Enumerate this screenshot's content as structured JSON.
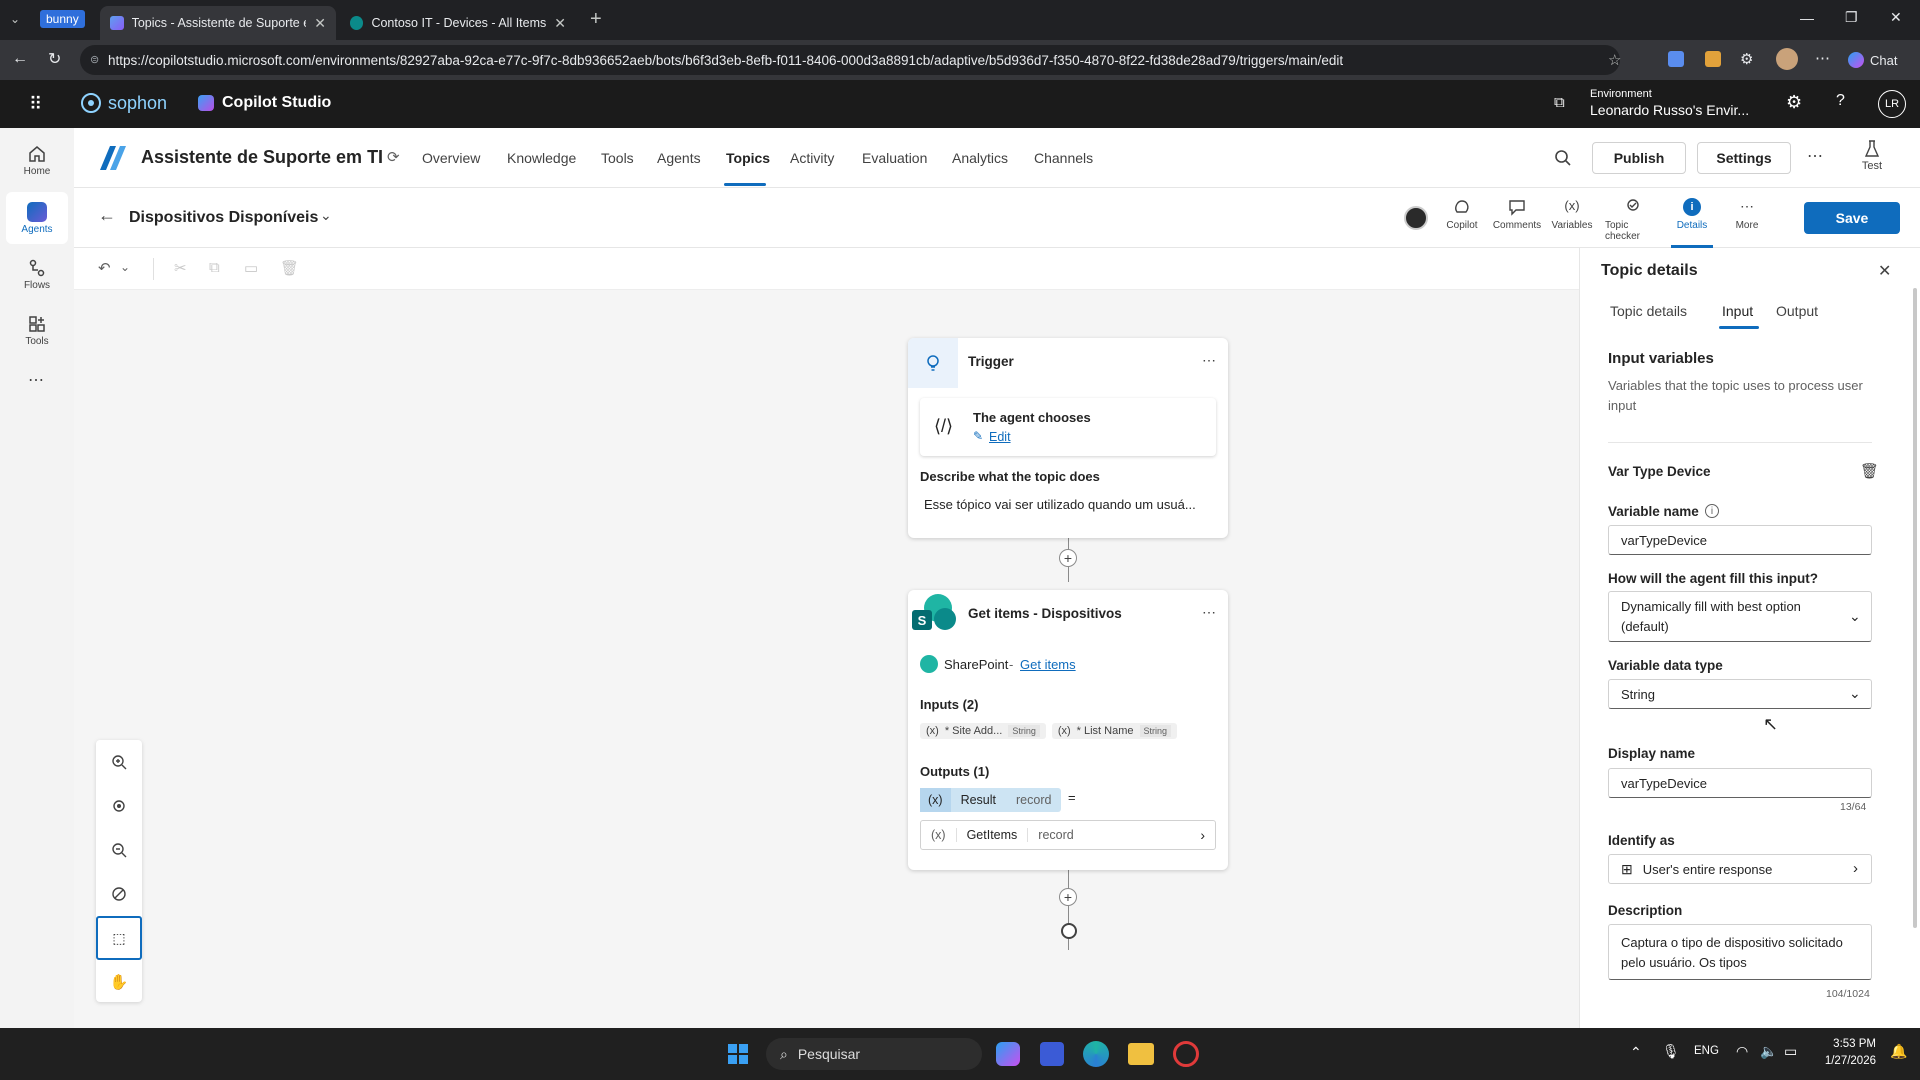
{
  "browser": {
    "profile_badge": "bunny",
    "tabs": [
      {
        "title": "Topics - Assistente de Suporte em"
      },
      {
        "title": "Contoso IT - Devices - All Items"
      }
    ],
    "url": "https://copilotstudio.microsoft.com/environments/82927aba-92ca-e77c-9f7c-8db936652aeb/bots/b6f3d3eb-8efb-f011-8406-000d3a8891cb/adaptive/b5d936d7-f350-4870-8f22-fd38de28ad79/triggers/main/edit",
    "chat_label": "Chat"
  },
  "app": {
    "brand": "sophon",
    "product": "Copilot Studio",
    "env_label": "Environment",
    "env_name": "Leonardo Russo's Envir...",
    "avatar": "LR"
  },
  "rail": {
    "items": [
      {
        "label": "Home"
      },
      {
        "label": "Agents"
      },
      {
        "label": "Flows"
      },
      {
        "label": "Tools"
      }
    ]
  },
  "agent": {
    "name": "Assistente de Suporte em TI",
    "nav": [
      "Overview",
      "Knowledge",
      "Tools",
      "Agents",
      "Topics",
      "Activity",
      "Evaluation",
      "Analytics",
      "Channels"
    ],
    "publish": "Publish",
    "settings": "Settings",
    "test": "Test"
  },
  "topic": {
    "title": "Dispositivos Disponíveis",
    "tools": [
      {
        "label": "Copilot"
      },
      {
        "label": "Comments"
      },
      {
        "label": "Variables"
      },
      {
        "label": "Topic checker"
      },
      {
        "label": "Details"
      },
      {
        "label": "More"
      }
    ],
    "save": "Save"
  },
  "trigger_node": {
    "title": "Trigger",
    "chooser": "The agent chooses",
    "edit": "Edit",
    "describe_label": "Describe what the topic does",
    "describe_value": "Esse tópico vai ser utilizado quando um usuá..."
  },
  "action_node": {
    "title": "Get items - Dispositivos",
    "connector": "SharePoint",
    "action_link": "Get items",
    "inputs_label": "Inputs (2)",
    "inputs": [
      {
        "name": "* Site Add...",
        "type": "String"
      },
      {
        "name": "* List Name",
        "type": "String"
      }
    ],
    "outputs_label": "Outputs (1)",
    "output_name": "Result",
    "output_type": "record",
    "assign_name": "GetItems",
    "assign_type": "record"
  },
  "panel": {
    "title": "Topic details",
    "tabs": [
      "Topic details",
      "Input",
      "Output"
    ],
    "section_title": "Input variables",
    "section_desc": "Variables that the topic uses to process user input",
    "var_title": "Var Type Device",
    "var_name_label": "Variable name",
    "var_name_value": "varTypeDevice",
    "fill_label": "How will the agent fill this input?",
    "fill_value": "Dynamically fill with best option (default)",
    "type_label": "Variable data type",
    "type_value": "String",
    "display_label": "Display name",
    "display_value": "varTypeDevice",
    "display_count": "13/64",
    "identify_label": "Identify as",
    "identify_value": "User's entire response",
    "desc_label": "Description",
    "desc_value": "Captura o tipo de dispositivo solicitado pelo usuário. Os tipos",
    "desc_count": "104/1024"
  },
  "taskbar": {
    "search": "Pesquisar",
    "lang": "ENG",
    "time": "3:53 PM",
    "date": "1/27/2026"
  },
  "colors": {
    "accent": "#0f6cbd",
    "app_header": "#1b1b1b"
  }
}
